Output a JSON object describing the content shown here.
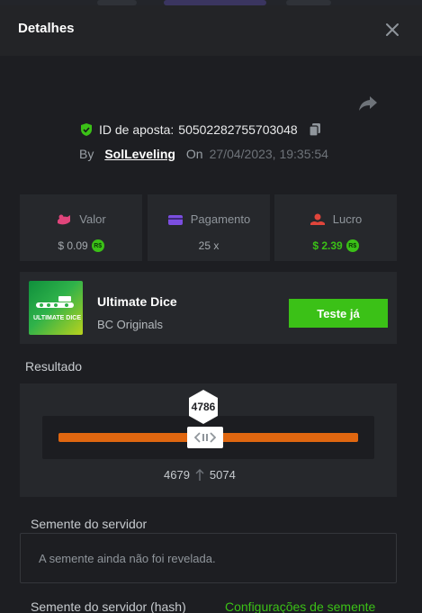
{
  "header": {
    "title": "Detalhes"
  },
  "bet": {
    "id_label": "ID de aposta:",
    "id_value": "50502282755703048",
    "by_label": "By",
    "username": "SolLeveling",
    "on_label": "On",
    "datetime": "27/04/2023, 19:35:54"
  },
  "stats": {
    "amount": {
      "label": "Valor",
      "value": "$ 0.09",
      "coin": "R$"
    },
    "payout": {
      "label": "Pagamento",
      "value": "25 x"
    },
    "profit": {
      "label": "Lucro",
      "value": "$ 2.39",
      "coin": "R$"
    }
  },
  "game": {
    "thumb_text": "ULTIMATE DICE",
    "name": "Ultimate Dice",
    "provider": "BC Originals",
    "try_label": "Teste já"
  },
  "result": {
    "label": "Resultado",
    "value": "4786",
    "range_low": "4679",
    "range_high": "5074",
    "range_low_fraction": 0.4679,
    "range_high_fraction": 0.5074
  },
  "server_seed": {
    "label": "Semente do servidor",
    "placeholder": "A semente ainda não foi revelada."
  },
  "server_seed_hash": {
    "label": "Semente do servidor (hash)",
    "config_link": "Configurações de semente"
  },
  "colors": {
    "accent_green": "#3bc117",
    "track_orange": "#e06710",
    "panel_bg": "#26282c"
  }
}
